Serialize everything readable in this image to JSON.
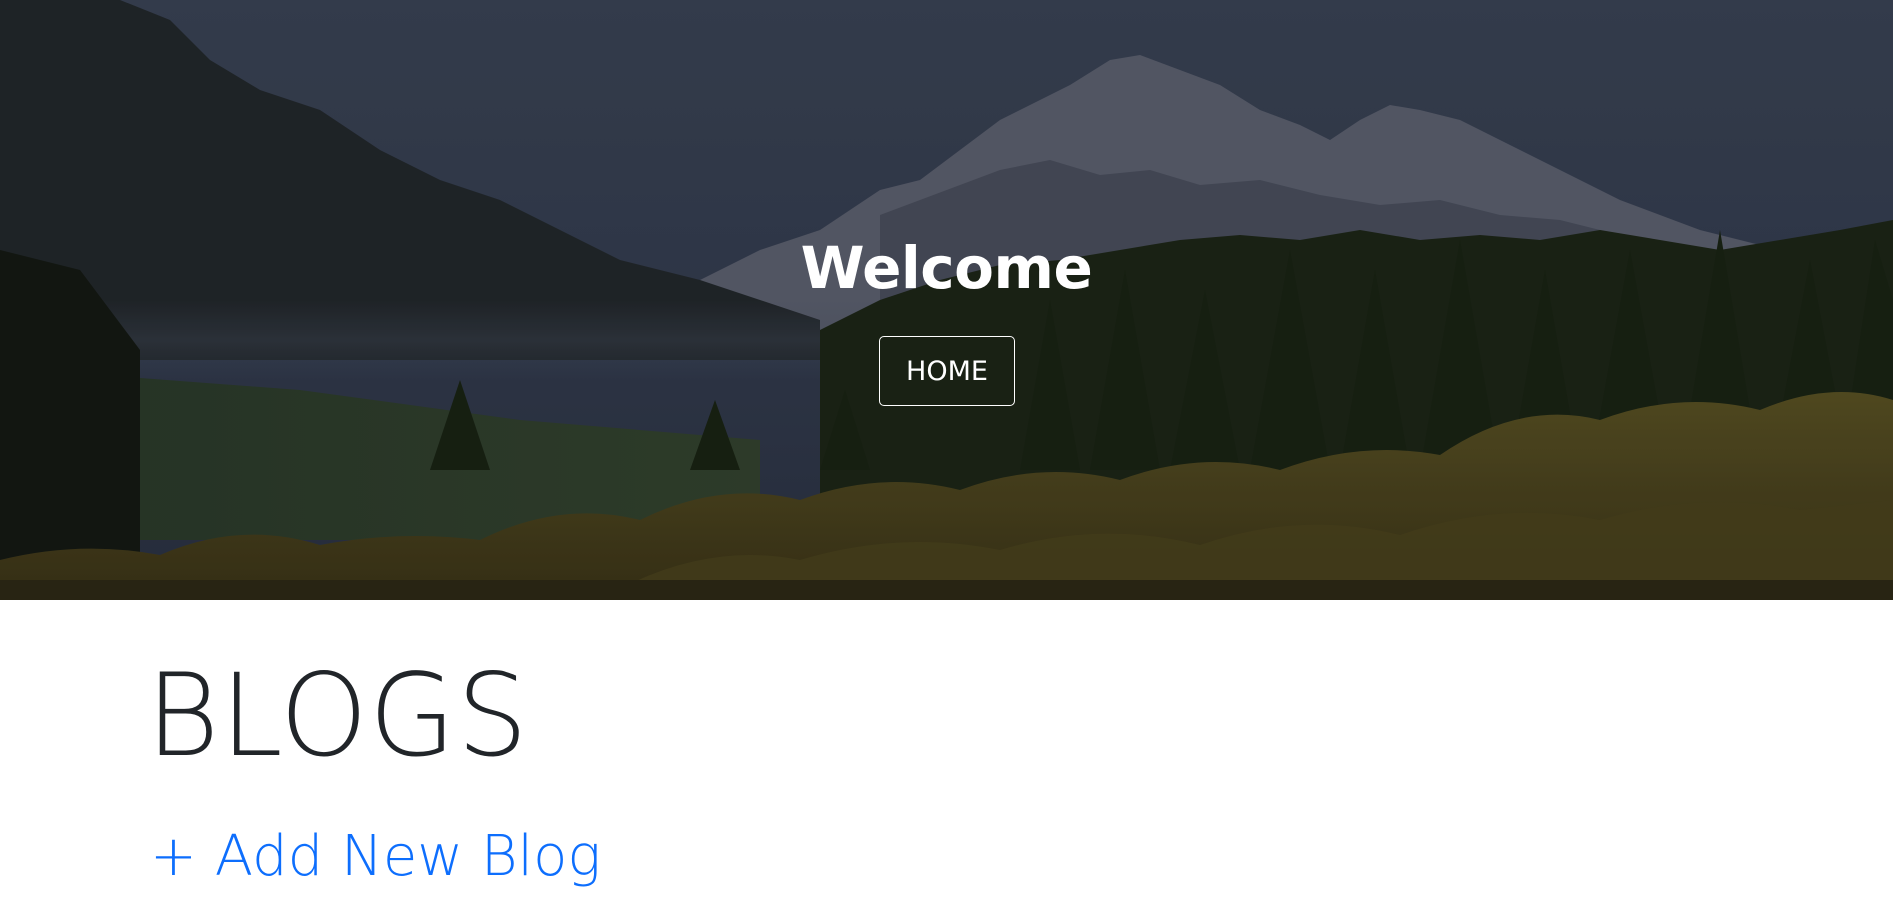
{
  "hero": {
    "title": "Welcome",
    "home_button_label": "HOME",
    "background": "mountain-forest-landscape"
  },
  "main": {
    "heading": "BLOGS",
    "add_blog_link": "+ Add New Blog"
  },
  "colors": {
    "link": "#0d6efd",
    "heading_text": "#212529",
    "hero_text": "#ffffff"
  }
}
